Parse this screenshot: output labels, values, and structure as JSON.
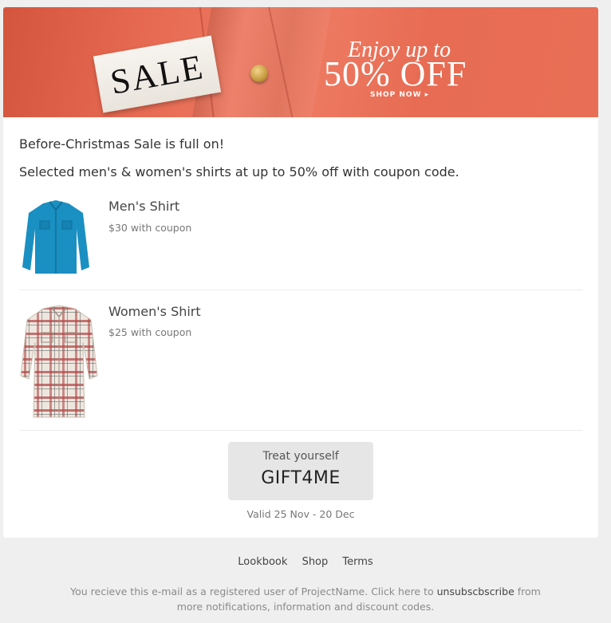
{
  "hero": {
    "sale_tag": "SALE",
    "offer_line1": "Enjoy up to",
    "offer_line2": "50% OFF",
    "shop_now": "SHOP NOW ▸"
  },
  "intro": {
    "line1": "Before-Christmas Sale is full on!",
    "line2": "Selected men's & women's shirts at up to 50% off with coupon code."
  },
  "products": [
    {
      "name": "Men's Shirt",
      "price": "$30 with coupon"
    },
    {
      "name": "Women's Shirt",
      "price": "$25 with coupon"
    }
  ],
  "coupon": {
    "label": "Treat yourself",
    "code": "GIFT4ME",
    "validity": "Valid 25 Nov - 20 Dec"
  },
  "footer": {
    "links": [
      "Lookbook",
      "Shop",
      "Terms"
    ],
    "note_before": "You recieve this e-mail as a registered user of ProjectName. Click here to ",
    "note_link": "unsubscbscribe",
    "note_after": " from more notifications, information and discount codes."
  },
  "colors": {
    "hero_bg": "#e76a52",
    "page_bg": "#efefef",
    "coupon_bg": "#e6e6e6"
  }
}
